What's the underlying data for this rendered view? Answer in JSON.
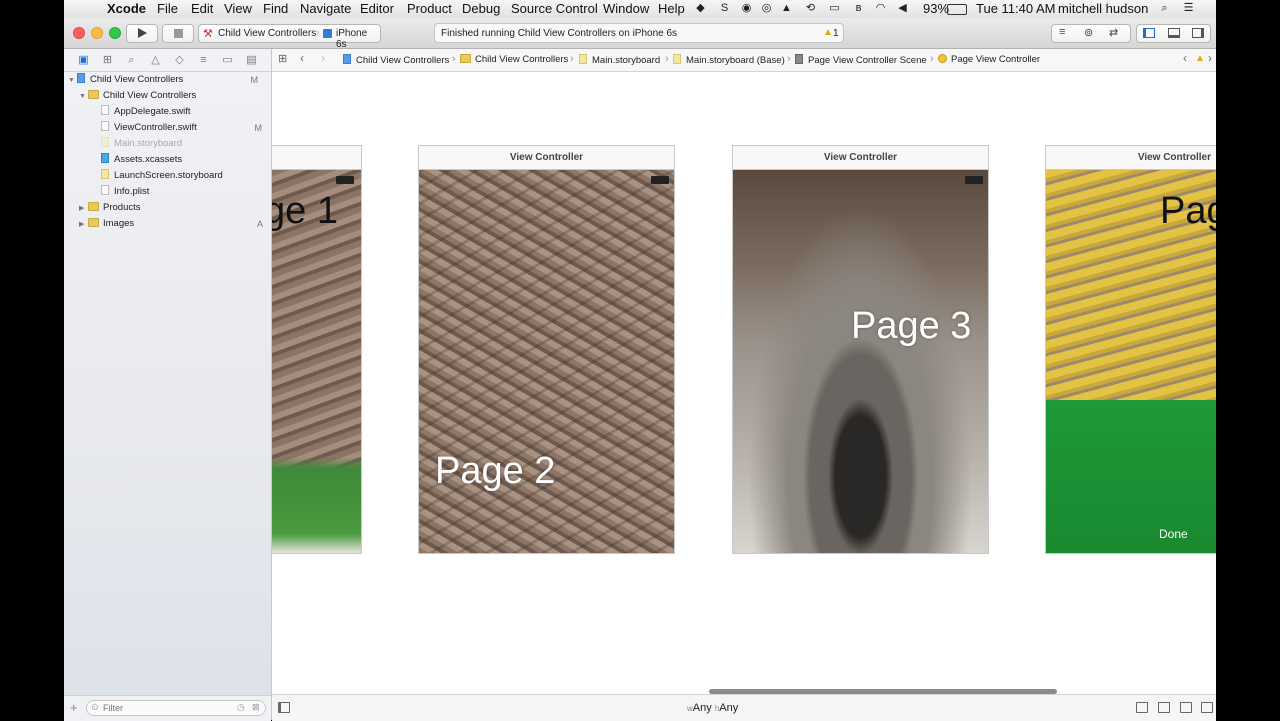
{
  "menubar": {
    "app_name": "Xcode",
    "items": [
      "File",
      "Edit",
      "View",
      "Find",
      "Navigate",
      "Editor",
      "Product",
      "Debug",
      "Source Control",
      "Window",
      "Help"
    ],
    "battery": "93%",
    "clock": "Tue 11:40 AM",
    "user": "mitchell hudson"
  },
  "toolbar": {
    "scheme": "Child View Controllers",
    "device": "iPhone 6s",
    "activity": "Finished running Child View Controllers on iPhone 6s",
    "warning_count": "1"
  },
  "navigator": {
    "project": {
      "label": "Child View Controllers",
      "badge": "M"
    },
    "group": {
      "label": "Child View Controllers"
    },
    "files": [
      {
        "label": "AppDelegate.swift",
        "badge": ""
      },
      {
        "label": "ViewController.swift",
        "badge": "M"
      },
      {
        "label": "Main.storyboard",
        "badge": ""
      },
      {
        "label": "Assets.xcassets",
        "badge": ""
      },
      {
        "label": "LaunchScreen.storyboard",
        "badge": ""
      },
      {
        "label": "Info.plist",
        "badge": ""
      }
    ],
    "products": {
      "label": "Products",
      "badge": ""
    },
    "images": {
      "label": "Images",
      "badge": "A"
    },
    "filter_placeholder": "Filter"
  },
  "jumpbar": {
    "crumbs": [
      "Child View Controllers",
      "Child View Controllers",
      "Main.storyboard",
      "Main.storyboard (Base)",
      "Page View Controller Scene",
      "Page View Controller"
    ]
  },
  "canvas": {
    "scenes": [
      {
        "title": "",
        "page_label": "ge 1"
      },
      {
        "title": "View Controller",
        "page_label": "Page 2"
      },
      {
        "title": "View Controller",
        "page_label": "Page 3"
      },
      {
        "title": "View Controller",
        "page_label": "Pag",
        "button_label": "Done"
      }
    ]
  },
  "bottombar": {
    "w_prefix": "w",
    "w_value": "Any",
    "h_prefix": "h",
    "h_value": "Any"
  }
}
